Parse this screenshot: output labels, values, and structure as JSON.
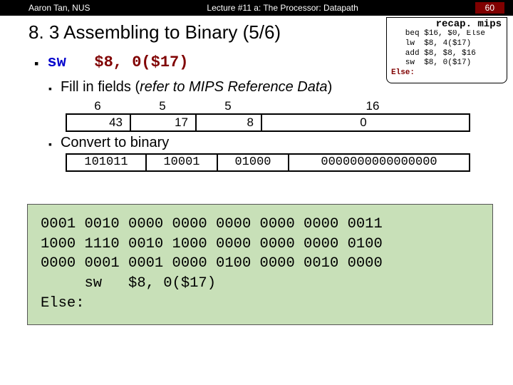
{
  "header": {
    "left": "Aaron Tan, NUS",
    "center": "Lecture #11 a: The Processor: Datapath",
    "right": "60"
  },
  "title": "8. 3   Assembling to Binary (5/6)",
  "recap": {
    "label": "recap. mips",
    "lines": [
      "   beq $16, $0, Else",
      "   lw  $8, 4($17)",
      "   add $8, $8, $16",
      "   sw  $8, 0($17)",
      "Else:"
    ]
  },
  "instr": {
    "op": "sw",
    "args": "$8, 0($17)"
  },
  "bullets": {
    "fill": "Fill in fields (",
    "fill_ref": "refer to MIPS Reference Data",
    "fill_close": ")",
    "convert": "Convert to binary"
  },
  "field_widths": {
    "a": "6",
    "b": "5",
    "c": "5",
    "d": "16"
  },
  "field_vals": {
    "a": "43",
    "b": "17",
    "c": "8",
    "d": "0"
  },
  "bin_vals": {
    "a": "101011",
    "b": "10001",
    "c": "01000",
    "d": "0000000000000000"
  },
  "code": {
    "r1": "0001 0010 0000 0000 0000 0000 0000 0011",
    "r2": "1000 1110 0010 1000 0000 0000 0000 0100",
    "r3": "0000 0001 0001 0000 0100 0000 0010 0000",
    "r4": "     sw   $8, 0($17)",
    "r5": "Else:"
  }
}
